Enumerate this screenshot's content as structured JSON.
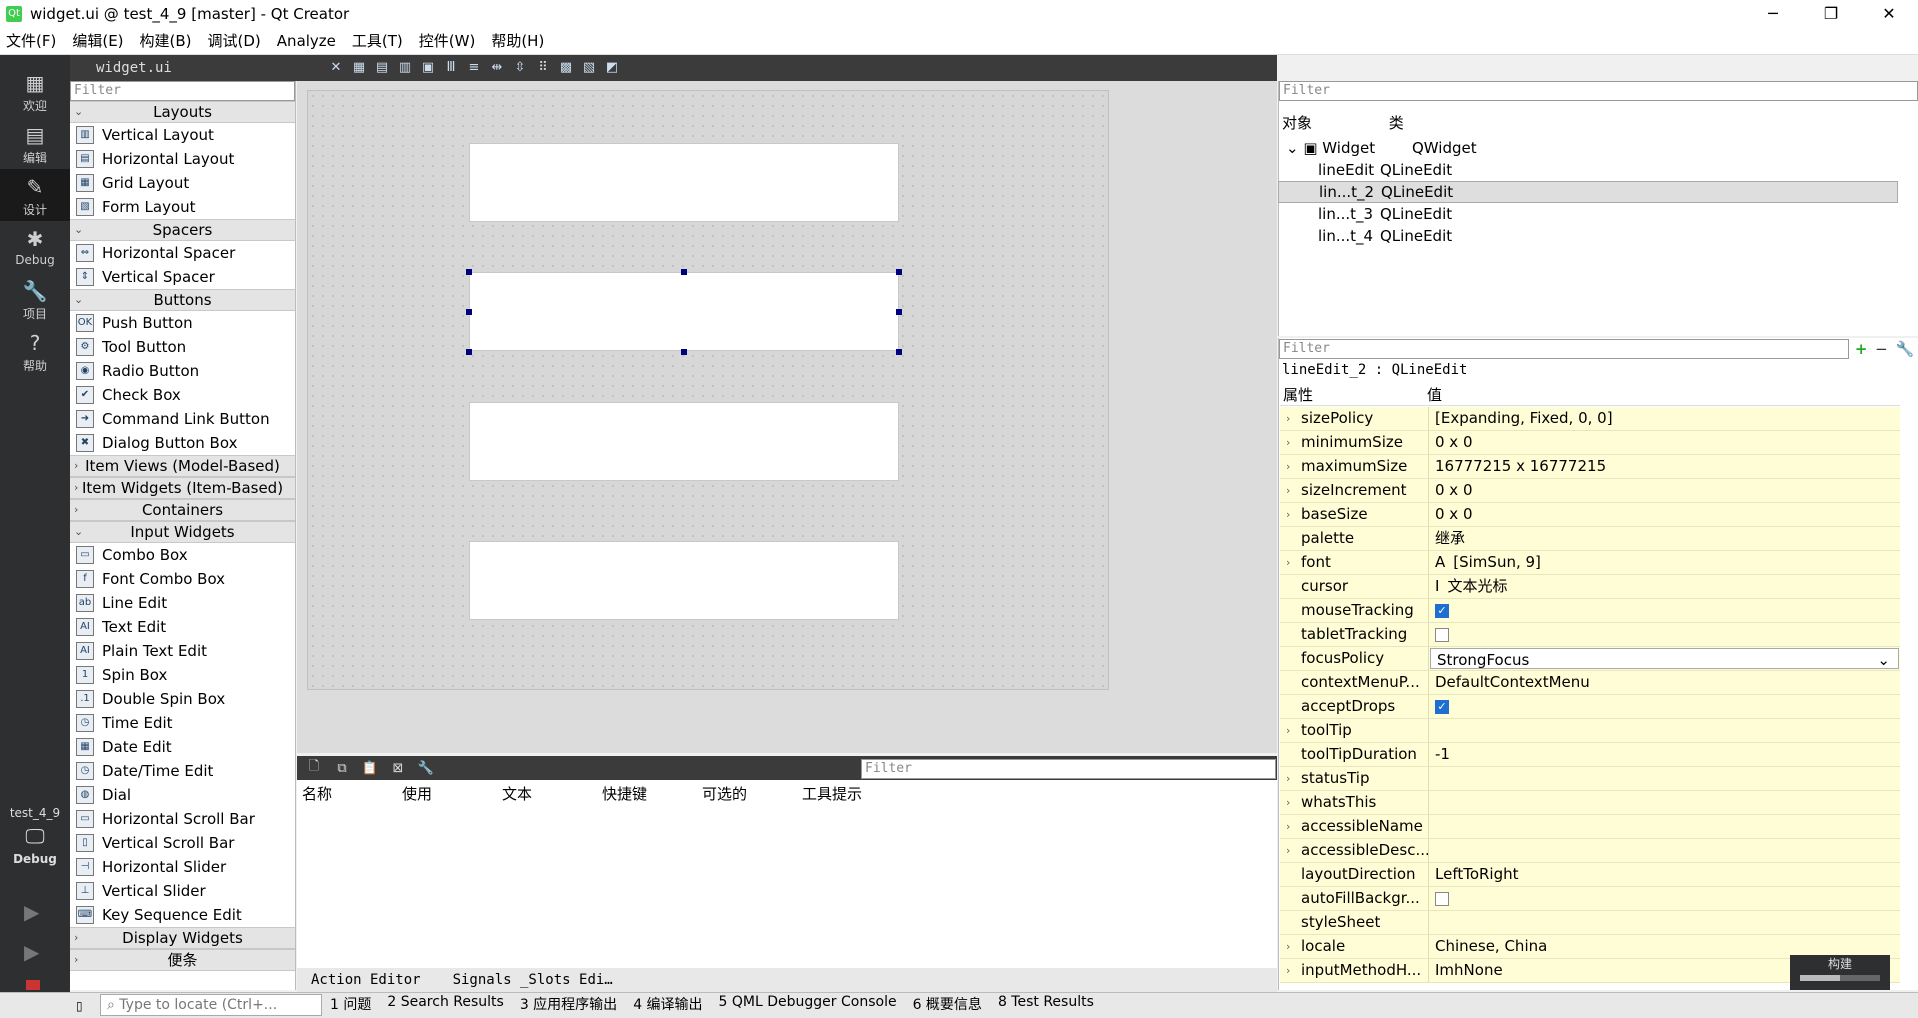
{
  "window": {
    "title": "widget.ui @ test_4_9 [master] - Qt Creator",
    "app_icon": "qt-icon"
  },
  "menus": [
    "文件(F)",
    "编辑(E)",
    "构建(B)",
    "调试(D)",
    "Analyze",
    "工具(T)",
    "控件(W)",
    "帮助(H)"
  ],
  "modes": [
    {
      "label": "欢迎",
      "icon": "grid-icon"
    },
    {
      "label": "编辑",
      "icon": "document-icon"
    },
    {
      "label": "设计",
      "icon": "pencil-icon"
    },
    {
      "label": "Debug",
      "icon": "bug-icon"
    },
    {
      "label": "项目",
      "icon": "wrench-icon"
    },
    {
      "label": "帮助",
      "icon": "help-icon"
    }
  ],
  "session": {
    "project": "test_4_9",
    "kit": "Debug"
  },
  "toolbar": {
    "file": "widget.ui"
  },
  "widgetbox": {
    "filter_placeholder": "Filter",
    "categories": [
      {
        "name": "Layouts",
        "items": [
          "Vertical Layout",
          "Horizontal Layout",
          "Grid Layout",
          "Form Layout"
        ]
      },
      {
        "name": "Spacers",
        "items": [
          "Horizontal Spacer",
          "Vertical Spacer"
        ]
      },
      {
        "name": "Buttons",
        "items": [
          "Push Button",
          "Tool Button",
          "Radio Button",
          "Check Box",
          "Command Link Button",
          "Dialog Button Box"
        ]
      },
      {
        "name": "Item Views (Model-Based)",
        "items": []
      },
      {
        "name": "Item Widgets (Item-Based)",
        "items": []
      },
      {
        "name": "Containers",
        "items": []
      },
      {
        "name": "Input Widgets",
        "items": [
          "Combo Box",
          "Font Combo Box",
          "Line Edit",
          "Text Edit",
          "Plain Text Edit",
          "Spin Box",
          "Double Spin Box",
          "Time Edit",
          "Date Edit",
          "Date/Time Edit",
          "Dial",
          "Horizontal Scroll Bar",
          "Vertical Scroll Bar",
          "Horizontal Slider",
          "Vertical Slider",
          "Key Sequence Edit"
        ]
      },
      {
        "name": "Display Widgets",
        "items": []
      },
      {
        "name": "便条",
        "items": []
      }
    ]
  },
  "action_editor": {
    "filter_placeholder": "Filter",
    "columns": [
      "名称",
      "使用",
      "文本",
      "快捷键",
      "可选的",
      "工具提示"
    ],
    "tabs": [
      "Action Editor",
      "Signals _Slots Edi…"
    ]
  },
  "object_inspector": {
    "filter_placeholder": "Filter",
    "col_object": "对象",
    "col_class": "类",
    "rows": [
      {
        "name": "Widget",
        "class": "QWidget"
      },
      {
        "name": "lineEdit",
        "class": "QLineEdit"
      },
      {
        "name": "lin...t_2",
        "class": "QLineEdit"
      },
      {
        "name": "lin...t_3",
        "class": "QLineEdit"
      },
      {
        "name": "lin...t_4",
        "class": "QLineEdit"
      }
    ]
  },
  "property_editor": {
    "filter_placeholder": "Filter",
    "object_label": "lineEdit_2 : QLineEdit",
    "col_property": "属性",
    "col_value": "值",
    "rows": [
      {
        "name": "sizePolicy",
        "value": "[Expanding, Fixed, 0, 0]",
        "expandable": true
      },
      {
        "name": "minimumSize",
        "value": "0 x 0",
        "expandable": true
      },
      {
        "name": "maximumSize",
        "value": "16777215 x 16777215",
        "expandable": true
      },
      {
        "name": "sizeIncrement",
        "value": "0 x 0",
        "expandable": true
      },
      {
        "name": "baseSize",
        "value": "0 x 0",
        "expandable": true
      },
      {
        "name": "palette",
        "value": "继承",
        "expandable": false
      },
      {
        "name": "font",
        "value": "[SimSun, 9]",
        "expandable": true,
        "glyph": "A"
      },
      {
        "name": "cursor",
        "value": "文本光标",
        "expandable": false,
        "glyph": "I"
      },
      {
        "name": "mouseTracking",
        "value": "",
        "checkbox": true,
        "checked": true
      },
      {
        "name": "tabletTracking",
        "value": "",
        "checkbox": true,
        "checked": false
      },
      {
        "name": "focusPolicy",
        "value": "StrongFocus",
        "combo": true
      },
      {
        "name": "contextMenuP...",
        "value": "DefaultContextMenu"
      },
      {
        "name": "acceptDrops",
        "value": "",
        "checkbox": true,
        "checked": true
      },
      {
        "name": "toolTip",
        "value": "",
        "expandable": true
      },
      {
        "name": "toolTipDuration",
        "value": "-1"
      },
      {
        "name": "statusTip",
        "value": "",
        "expandable": true
      },
      {
        "name": "whatsThis",
        "value": "",
        "expandable": true
      },
      {
        "name": "accessibleName",
        "value": "",
        "expandable": true
      },
      {
        "name": "accessibleDesc...",
        "value": "",
        "expandable": true
      },
      {
        "name": "layoutDirection",
        "value": "LeftToRight"
      },
      {
        "name": "autoFillBackgr...",
        "value": "",
        "checkbox": true,
        "checked": false
      },
      {
        "name": "styleSheet",
        "value": ""
      },
      {
        "name": "locale",
        "value": "Chinese, China",
        "expandable": true
      },
      {
        "name": "inputMethodH...",
        "value": "ImhNone",
        "expandable": true
      }
    ]
  },
  "build_label": "构建",
  "statusbar": {
    "locate_placeholder": "Type to locate (Ctrl+...",
    "tabs": [
      "1 问题",
      "2 Search Results",
      "3 应用程序输出",
      "4 编译输出",
      "5 QML Debugger Console",
      "6 概要信息",
      "8 Test Results"
    ]
  }
}
